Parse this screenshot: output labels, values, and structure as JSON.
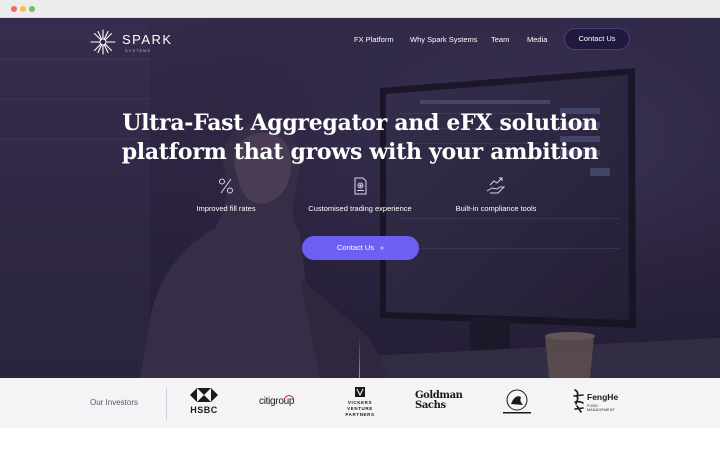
{
  "brand": {
    "name": "SPARK",
    "tagline": "SYSTEMS"
  },
  "nav": {
    "items": [
      "FX Platform",
      "Why Spark Systems",
      "Team",
      "Media"
    ],
    "contact_label": "Contact Us"
  },
  "hero": {
    "headline_line1": "Ultra-Fast Aggregator and eFX solution",
    "headline_line2": "platform that grows with your ambition",
    "features": [
      {
        "label": "Improved fill rates",
        "icon": "percent-icon"
      },
      {
        "label": "Customised trading experience",
        "icon": "document-settings-icon"
      },
      {
        "label": "Built-in compliance tools",
        "icon": "hand-chart-icon"
      }
    ],
    "cta_label": "Contact Us",
    "cta_chevron": "»"
  },
  "investors": {
    "label": "Our Investors",
    "logos": {
      "hsbc": "HSBC",
      "citi": "citigroup",
      "vickers_line1": "VICKERS",
      "vickers_line2": "VENTURE",
      "vickers_line3": "PARTNERS",
      "gs_line1": "Goldman",
      "gs_line2": "Sachs",
      "fenghe": "FengHe",
      "fenghe_sub": "FUND MANAGEMENT"
    }
  },
  "colors": {
    "accent": "#6c5ff2",
    "hero_bg": "#2d2541",
    "band_bg": "#f4f4f6"
  }
}
